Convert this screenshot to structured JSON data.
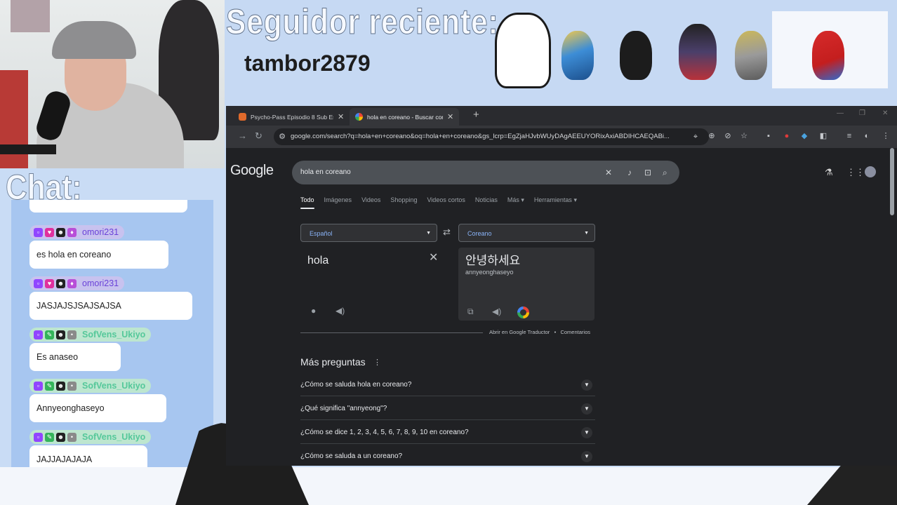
{
  "overlay": {
    "banner_title": "Seguidor reciente:",
    "recent_follower": "tambor2879",
    "chat_title": "Chat:"
  },
  "chat": {
    "messages": [
      {
        "user": "omori231",
        "text": "es hola en coreano",
        "style": "purple"
      },
      {
        "user": "omori231",
        "text": "JASJAJSJSAJSAJSA",
        "style": "purple"
      },
      {
        "user": "SofVens_Ukiyo",
        "text": "Es anaseo",
        "style": "green"
      },
      {
        "user": "SofVens_Ukiyo",
        "text": "Annyeonghaseyo",
        "style": "green"
      },
      {
        "user": "SofVens_Ukiyo",
        "text": "JAJJAJAJAJA",
        "style": "green"
      }
    ]
  },
  "browser": {
    "tabs": [
      {
        "label": "Psycho-Pass Episodio 8 Sub Esp",
        "active": false
      },
      {
        "label": "hola en coreano - Buscar con",
        "active": true
      }
    ],
    "url": "google.com/search?q=hola+en+coreano&oq=hola+en+coreano&gs_lcrp=EgZjaHJvbWUyDAgAEEUYORixAxiABDIHCAEQABi..."
  },
  "google": {
    "logo": "Google",
    "query": "hola en coreano",
    "tabs": [
      "Todo",
      "Imágenes",
      "Videos",
      "Shopping",
      "Videos cortos",
      "Noticias",
      "Más",
      "Herramientas"
    ],
    "translate": {
      "source_lang": "Español",
      "target_lang": "Coreano",
      "source_text": "hola",
      "target_text": "안녕하세요",
      "romanization": "annyeonghaseyo",
      "open_link": "Abrir en Google Traductor",
      "separator": "•",
      "feedback": "Comentarios"
    },
    "paa": {
      "title": "Más preguntas",
      "questions": [
        "¿Cómo se saluda hola en coreano?",
        "¿Qué significa \"annyeong\"?",
        "¿Cómo se dice 1, 2, 3, 4, 5, 6, 7, 8, 9, 10 en coreano?",
        "¿Cómo se saluda a un coreano?"
      ]
    }
  },
  "icons": {
    "close": "✕",
    "plus": "+",
    "back": "→",
    "reload": "↻",
    "chevron_down": "⌄",
    "swap": "⇄",
    "mic": "🎤",
    "speaker": "🔊",
    "copy": "⧉",
    "more": "⋮"
  },
  "colors": {
    "accent_blue": "#8ab4f8",
    "overlay_blue": "#c9dcf5",
    "chat_purple": "#6a42d8",
    "chat_green": "#55c89a"
  }
}
